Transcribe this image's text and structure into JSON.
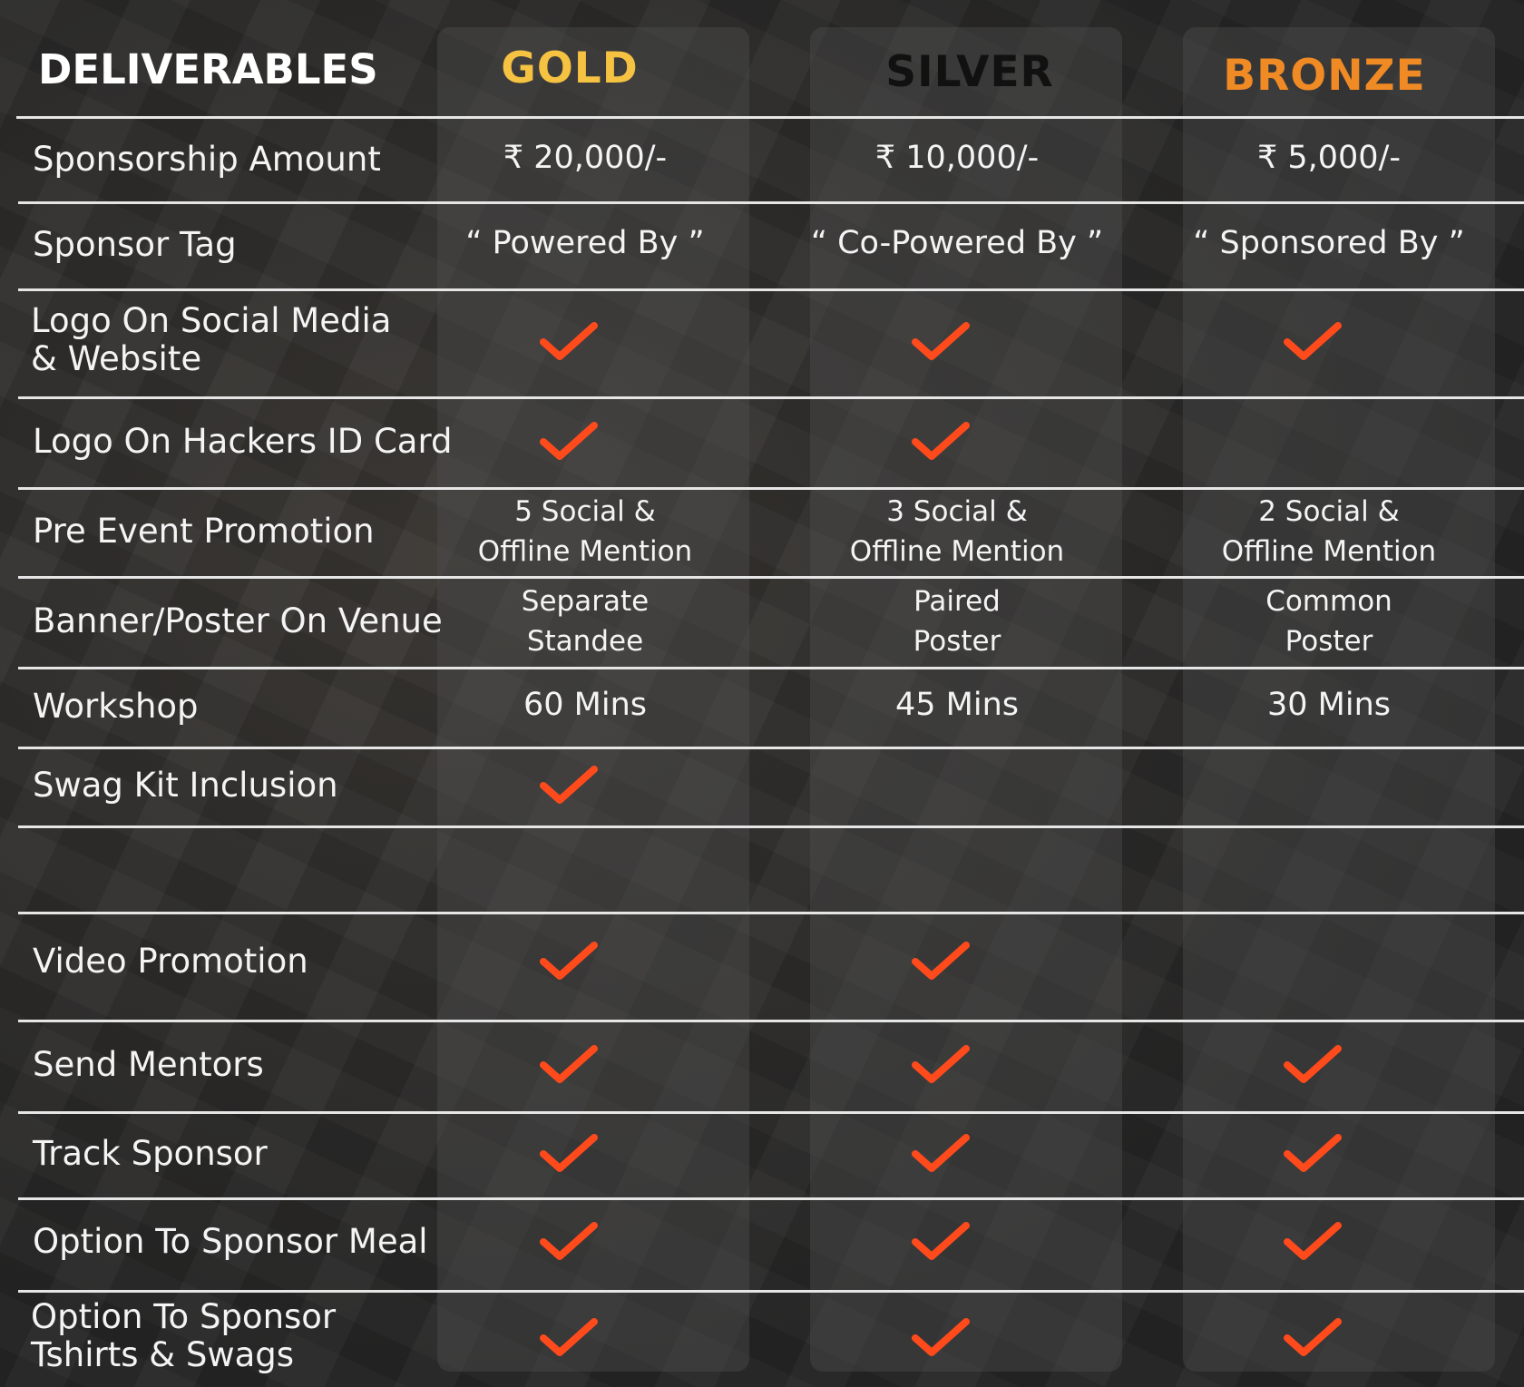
{
  "header": {
    "deliverables": "DELIVERABLES",
    "tiers": [
      {
        "name": "GOLD",
        "color": "#f5c242"
      },
      {
        "name": "SILVER",
        "color": "#111111"
      },
      {
        "name": "BRONZE",
        "color": "#f08a24"
      }
    ]
  },
  "check_color": "#ff4a1c",
  "rows": [
    {
      "label": "Sponsorship Amount",
      "cells": [
        "₹ 20,000/-",
        "₹ 10,000/-",
        "₹ 5,000/-"
      ]
    },
    {
      "label": "Sponsor Tag",
      "cells": [
        "“ Powered By ”",
        "“ Co-Powered By ”",
        "“ Sponsored By ”"
      ]
    },
    {
      "label_lines": [
        "Logo On Social Media",
        "& Website"
      ],
      "checks": [
        true,
        true,
        true
      ]
    },
    {
      "label": "Logo On Hackers ID Card",
      "checks": [
        true,
        true,
        false
      ]
    },
    {
      "label": "Pre Event Promotion",
      "cells_lines": [
        [
          "5 Social &",
          "Offline Mention"
        ],
        [
          "3 Social &",
          "Offline Mention"
        ],
        [
          "2 Social &",
          "Offline Mention"
        ]
      ]
    },
    {
      "label": "Banner/Poster On Venue",
      "cells_lines": [
        [
          "Separate",
          "Standee"
        ],
        [
          "Paired",
          "Poster"
        ],
        [
          "Common",
          "Poster"
        ]
      ]
    },
    {
      "label": "Workshop",
      "cells": [
        "60 Mins",
        "45 Mins",
        "30 Mins"
      ]
    },
    {
      "label": "Swag Kit Inclusion",
      "checks": [
        true,
        false,
        false
      ]
    },
    {
      "label": "Video Promotion",
      "checks": [
        true,
        true,
        false
      ]
    },
    {
      "label": "Send Mentors",
      "checks": [
        true,
        true,
        true
      ]
    },
    {
      "label": "Track Sponsor",
      "checks": [
        true,
        true,
        true
      ]
    },
    {
      "label": "Option To Sponsor Meal",
      "checks": [
        true,
        true,
        true
      ]
    },
    {
      "label_lines": [
        "Option To Sponsor",
        "Tshirts & Swags"
      ],
      "checks": [
        true,
        true,
        true
      ]
    }
  ]
}
